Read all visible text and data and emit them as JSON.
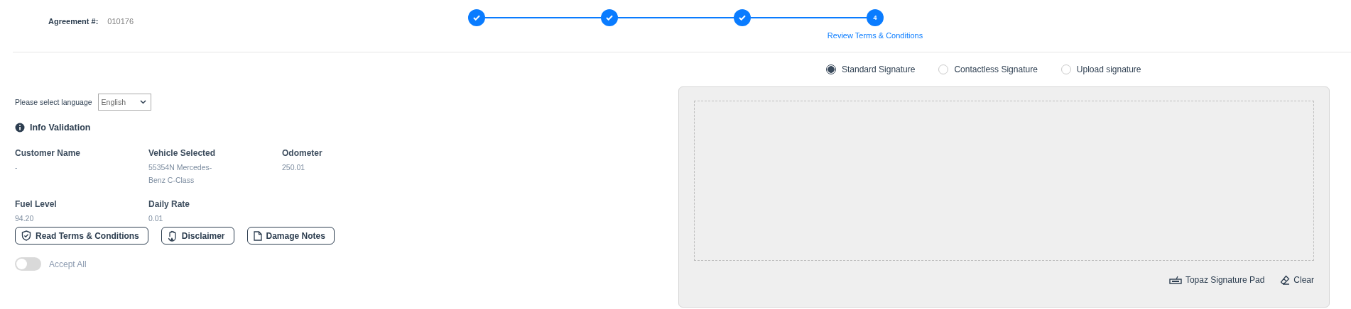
{
  "agreement": {
    "label": "Agreement #:",
    "value": "010176"
  },
  "stepper": {
    "steps": [
      {
        "completed": true
      },
      {
        "completed": true
      },
      {
        "completed": true
      },
      {
        "completed": false,
        "number": "4",
        "label": "Review Terms & Conditions"
      }
    ]
  },
  "language": {
    "label": "Please select language",
    "value": "English"
  },
  "info_validation": {
    "title": "Info Validation",
    "fields": [
      {
        "label": "Customer Name",
        "value": "-"
      },
      {
        "label": "Vehicle Selected",
        "value": "55354N Mercedes-Benz C-Class"
      },
      {
        "label": "Odometer",
        "value": "250.01"
      },
      {
        "label": "Fuel Level",
        "value": "94.20"
      },
      {
        "label": "Daily Rate",
        "value": "0.01"
      }
    ]
  },
  "buttons": [
    {
      "label": "Read Terms & Conditions",
      "kind": "shield"
    },
    {
      "label": "Disclaimer",
      "kind": "hand"
    },
    {
      "label": "Damage Notes",
      "kind": "note"
    }
  ],
  "accept_all": {
    "label": "Accept All",
    "on": false
  },
  "signature_options": [
    {
      "label": "Standard Signature",
      "selected": true
    },
    {
      "label": "Contactless Signature",
      "selected": false
    },
    {
      "label": "Upload signature",
      "selected": false
    }
  ],
  "signature_pad": {
    "actions": [
      {
        "label": "Topaz Signature Pad",
        "kind": "pad"
      },
      {
        "label": "Clear",
        "kind": "eraser"
      }
    ]
  }
}
